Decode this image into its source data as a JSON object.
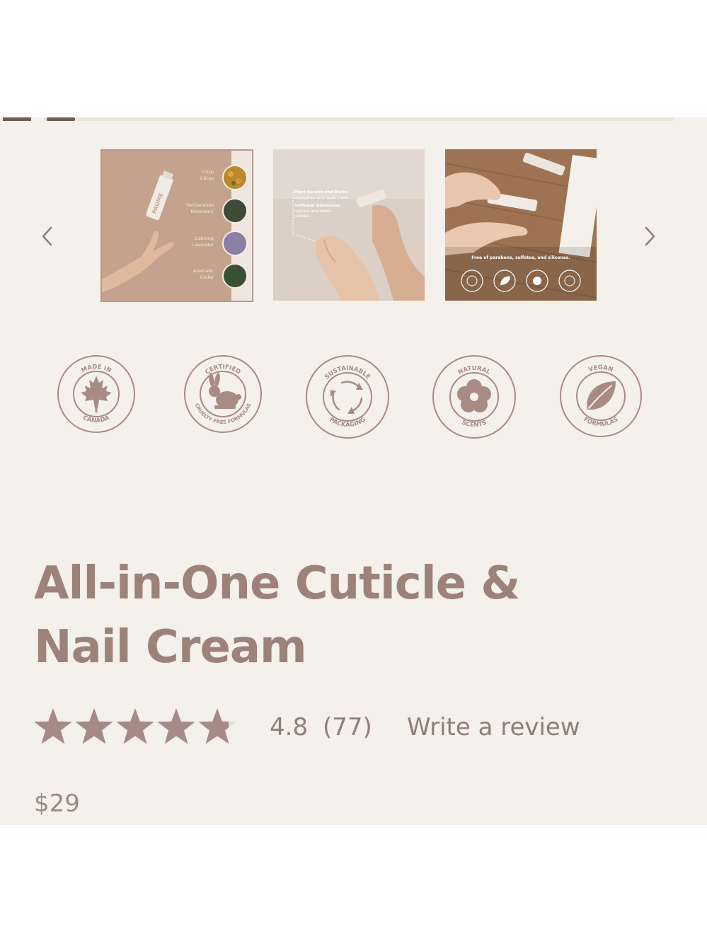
{
  "gallery": {
    "thumb1": {
      "labels": [
        [
          "Crisp",
          "Citrus"
        ],
        [
          "Herbaceous",
          "Rosemary"
        ],
        [
          "Calming",
          "Lavender"
        ],
        [
          "Aromatic",
          "Cedar"
        ]
      ],
      "tube_brand": "PAUME"
    },
    "thumb2": {
      "line1": "Plant Keratin and Biotin",
      "line2": "strengthen and repair nails.",
      "line3": "Safflower Oleosomes",
      "line4": "hydrate and soften",
      "line5": "cuticles."
    },
    "thumb3": {
      "caption": "Free of parabens, sulfates, and silicones."
    }
  },
  "badges": [
    {
      "top": "MADE IN",
      "bottom": "CANADA",
      "icon": "maple-leaf-icon"
    },
    {
      "top": "CERTIFIED",
      "bottom": "CRUELTY FREE FORMULAS",
      "icon": "rabbit-icon"
    },
    {
      "top": "SUSTAINABLE",
      "bottom": "PACKAGING",
      "icon": "recycle-arrows-icon"
    },
    {
      "top": "NATURAL",
      "bottom": "SCENTS",
      "icon": "flower-icon"
    },
    {
      "top": "VEGAN",
      "bottom": "FORMULAS",
      "icon": "leaf-icon"
    }
  ],
  "product": {
    "title_line1": "All-in-One Cuticle &",
    "title_line2": "Nail Cream",
    "rating": 4.8,
    "rating_value_text": "4.8",
    "rating_count_text": "(77)",
    "write_review": "Write a review",
    "price": "$29"
  },
  "colors": {
    "background": "#f4f0ea",
    "brand_text": "#9d8279",
    "star_fill": "#a68a86",
    "star_empty": "#eadbd0"
  }
}
